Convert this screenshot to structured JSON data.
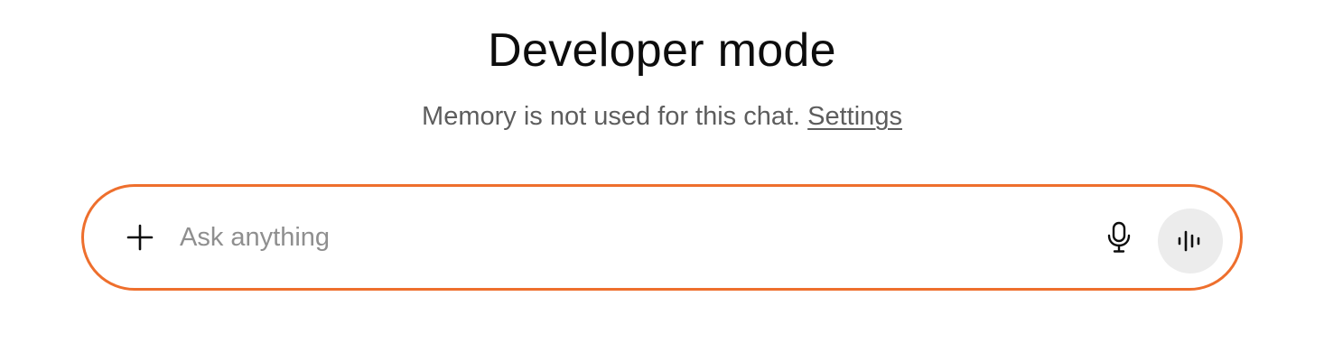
{
  "header": {
    "title": "Developer mode",
    "subtitle_text": "Memory is not used for this chat.",
    "settings_link_label": "Settings"
  },
  "composer": {
    "placeholder": "Ask anything",
    "value": "",
    "add_icon": "plus-icon",
    "mic_icon": "microphone-icon",
    "voice_icon": "voice-waveform-icon",
    "border_color": "#ee6f2d"
  }
}
